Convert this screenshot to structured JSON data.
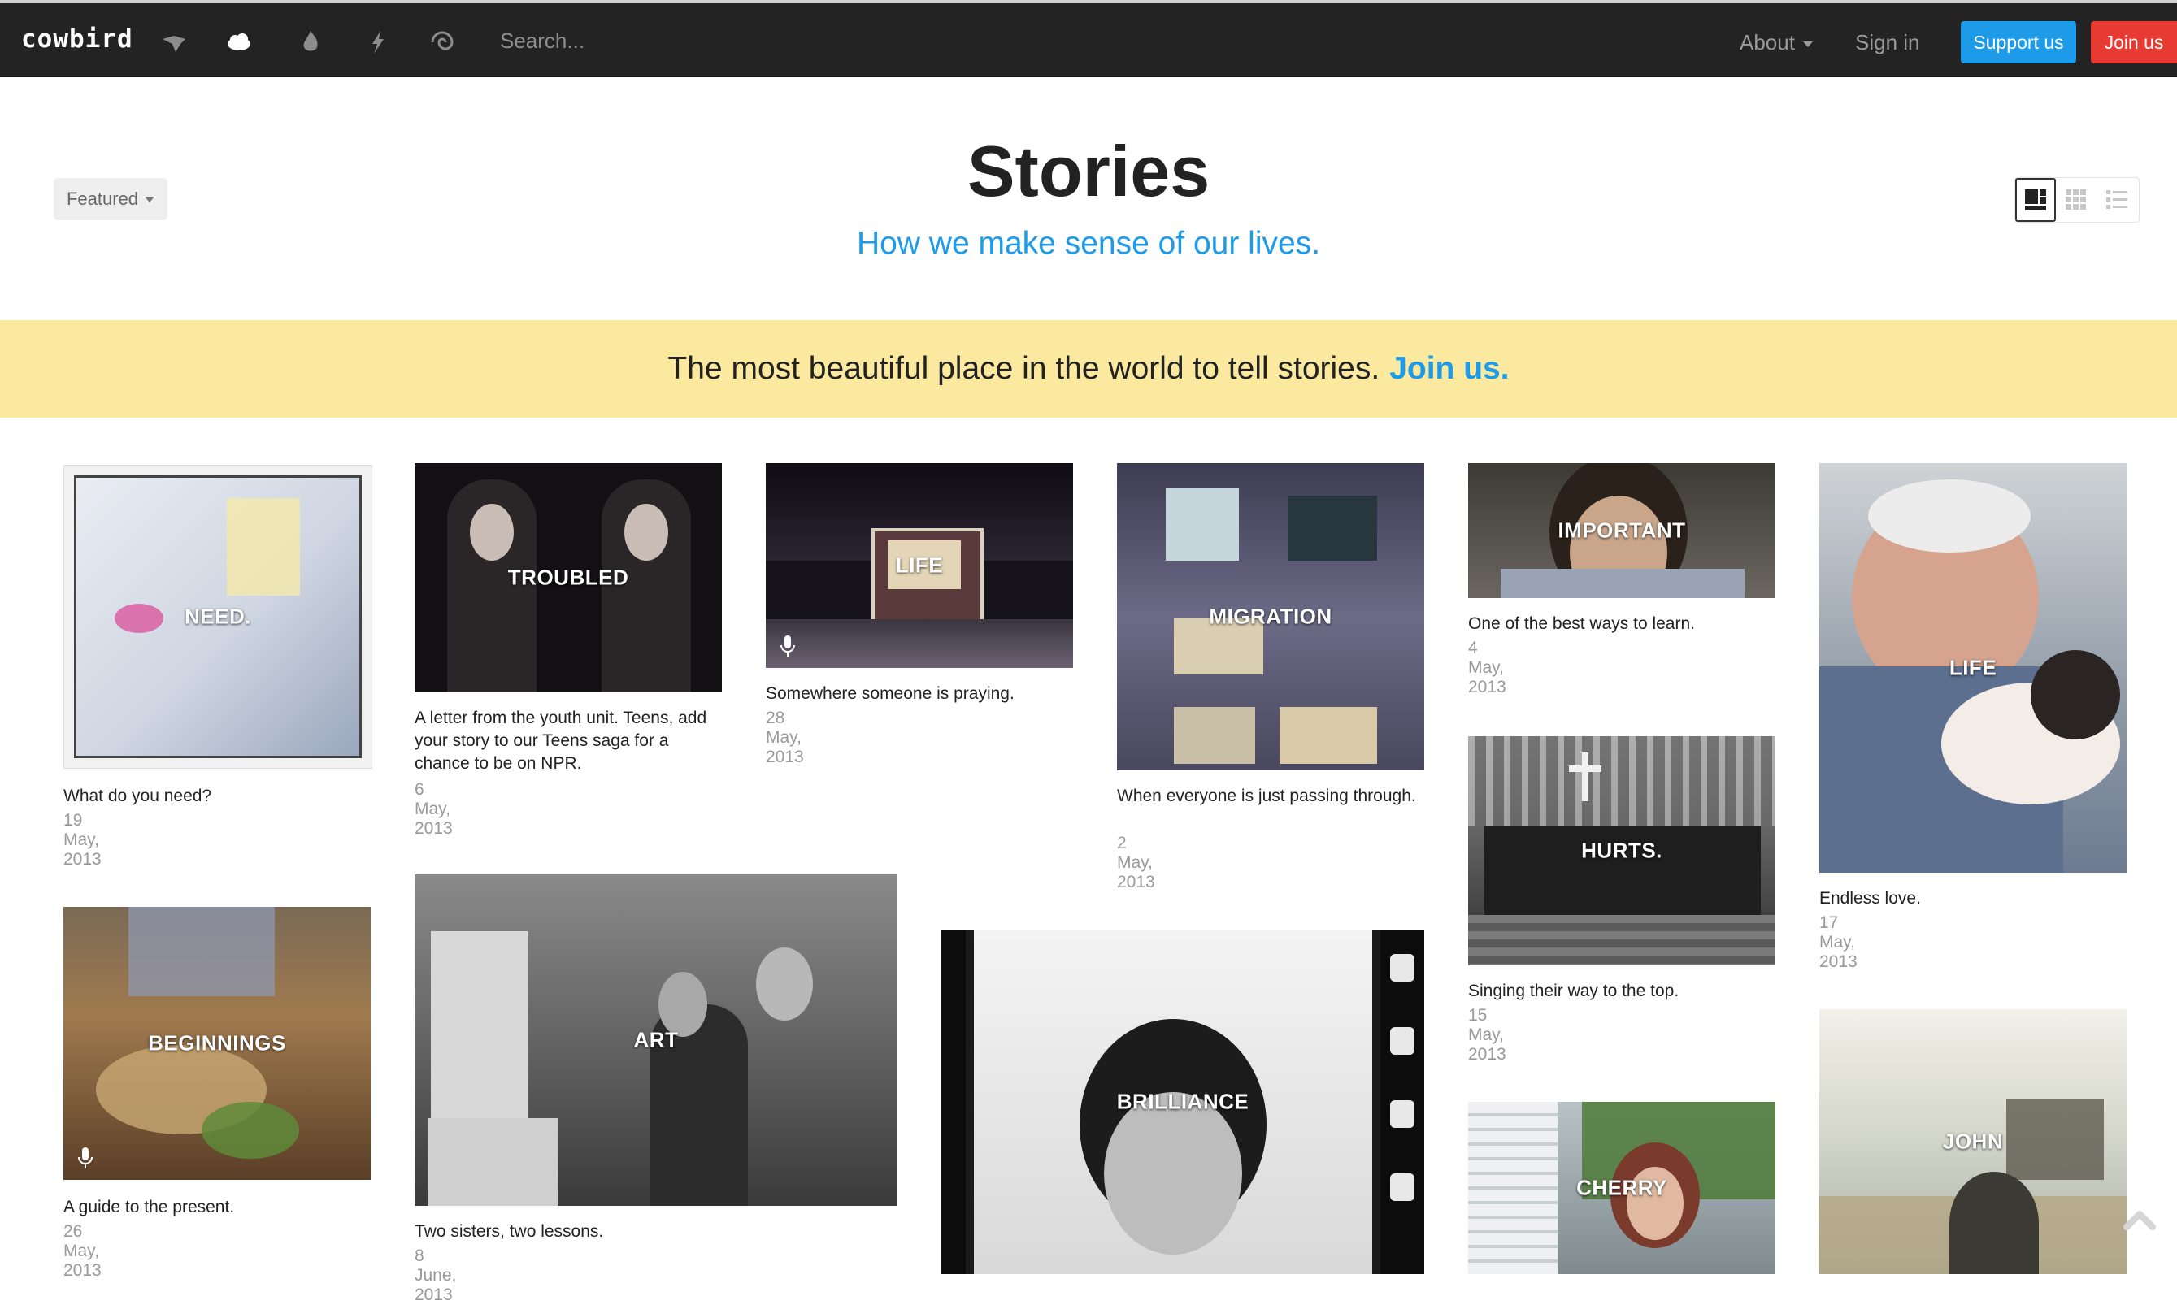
{
  "nav": {
    "logo": "cowbird",
    "icons": [
      "bird-icon",
      "cloud-icon",
      "fire-icon",
      "lightning-icon",
      "swirl-icon"
    ],
    "search_placeholder": "Search...",
    "about": "About",
    "sign_in": "Sign in",
    "support": "Support us",
    "join": "Join us"
  },
  "header": {
    "filter": "Featured",
    "title": "Stories",
    "subtitle": "How we make sense of our lives.",
    "views": [
      "mosaic-view-icon",
      "grid-view-icon",
      "list-view-icon"
    ]
  },
  "banner": {
    "text": "The most beautiful place in the world to tell stories.",
    "link": "Join us."
  },
  "stories": [
    {
      "tag": "NEED.",
      "caption": "What do you need?",
      "date": "19 May, 2013",
      "bg": "#cfd6e2"
    },
    {
      "tag": "TROUBLED",
      "caption": "A letter from the youth unit. Teens, add your story to our Teens saga for a chance to be on NPR.",
      "date": "6 May, 2013",
      "bg": "#1c1a1c"
    },
    {
      "tag": "LIFE",
      "caption": "Somewhere someone is praying.",
      "date": "28 May, 2013",
      "bg": "#2a2430"
    },
    {
      "tag": "MIGRATION",
      "caption": "When everyone is just passing through.",
      "date": "2 May, 2013",
      "bg": "#6c6a86"
    },
    {
      "tag": "IMPORTANT",
      "caption": "One of the best ways to learn.",
      "date": "4 May, 2013",
      "bg": "#6b6760"
    },
    {
      "tag": "LIFE",
      "caption": "Endless love.",
      "date": "17 May, 2013",
      "bg": "#6d7b92"
    },
    {
      "tag": "BEGINNINGS",
      "caption": "A guide to the present.",
      "date": "26 May, 2013",
      "bg": "#7b5a3c"
    },
    {
      "tag": "ART",
      "caption": "Two sisters, two lessons.",
      "date": "8 June, 2013",
      "bg": "#6d6d6d"
    },
    {
      "tag": "BRILLIANCE",
      "caption": "",
      "date": "",
      "bg": "#2a2a2a"
    },
    {
      "tag": "HURTS.",
      "caption": "Singing their way to the top.",
      "date": "15 May, 2013",
      "bg": "#4a4a4a"
    },
    {
      "tag": "CHERRY",
      "caption": "",
      "date": "",
      "bg": "#7e8a8e"
    },
    {
      "tag": "JOHN",
      "caption": "",
      "date": "",
      "bg": "#a8b0a6"
    }
  ]
}
